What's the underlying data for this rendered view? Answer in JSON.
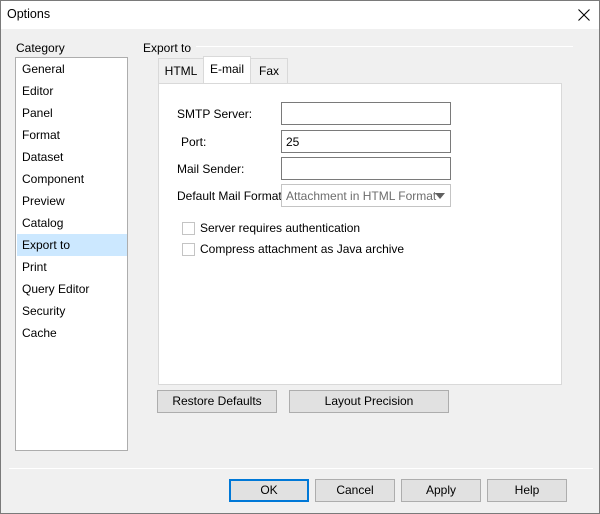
{
  "window": {
    "title": "Options"
  },
  "category": {
    "label": "Category",
    "items": [
      "General",
      "Editor",
      "Panel",
      "Format",
      "Dataset",
      "Component",
      "Preview",
      "Catalog",
      "Export to",
      "Print",
      "Query Editor",
      "Security",
      "Cache"
    ],
    "selected": "Export to"
  },
  "export": {
    "group_label": "Export to",
    "tabs": [
      "HTML",
      "E-mail",
      "Fax"
    ],
    "active_tab": "E-mail",
    "smtp_label": "SMTP Server:",
    "smtp_value": "",
    "port_label": "Port:",
    "port_value": "25",
    "sender_label": "Mail Sender:",
    "sender_value": "",
    "format_label": "Default Mail Format:",
    "format_value": "Attachment in HTML Format",
    "auth_label": "Server requires authentication",
    "auth_checked": false,
    "compress_label": "Compress attachment as Java archive",
    "compress_checked": false
  },
  "buttons": {
    "restore": "Restore Defaults",
    "layout": "Layout Precision",
    "ok": "OK",
    "cancel": "Cancel",
    "apply": "Apply",
    "help": "Help"
  },
  "colors": {
    "selection": "#cce8ff",
    "default_button_border": "#0078d7"
  }
}
